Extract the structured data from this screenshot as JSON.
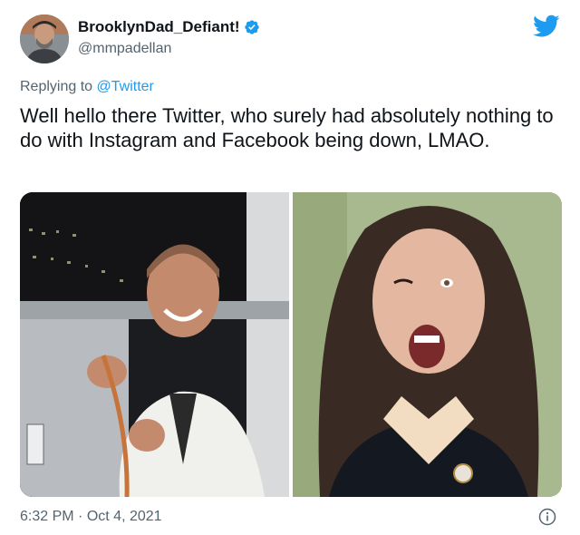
{
  "user": {
    "display_name": "BrooklynDad_Defiant!",
    "handle": "@mmpadellan",
    "avatar_icon": "avatar-photo"
  },
  "replying": {
    "prefix": "Replying to",
    "mention": "@Twitter"
  },
  "tweet": {
    "text": "Well hello there Twitter, who surely had absolutely nothing to do with Instagram and Facebook being down, LMAO."
  },
  "media": [
    {
      "description": "photo-left"
    },
    {
      "description": "photo-right"
    }
  ],
  "meta": {
    "time": "6:32 PM",
    "separator": "·",
    "date": "Oct 4, 2021"
  },
  "icons": {
    "verified": "verified-badge-icon",
    "brand": "twitter-bird-icon",
    "info": "info-icon"
  },
  "colors": {
    "accent": "#1d9bf0",
    "text": "#0f1419",
    "secondary": "#536471"
  }
}
